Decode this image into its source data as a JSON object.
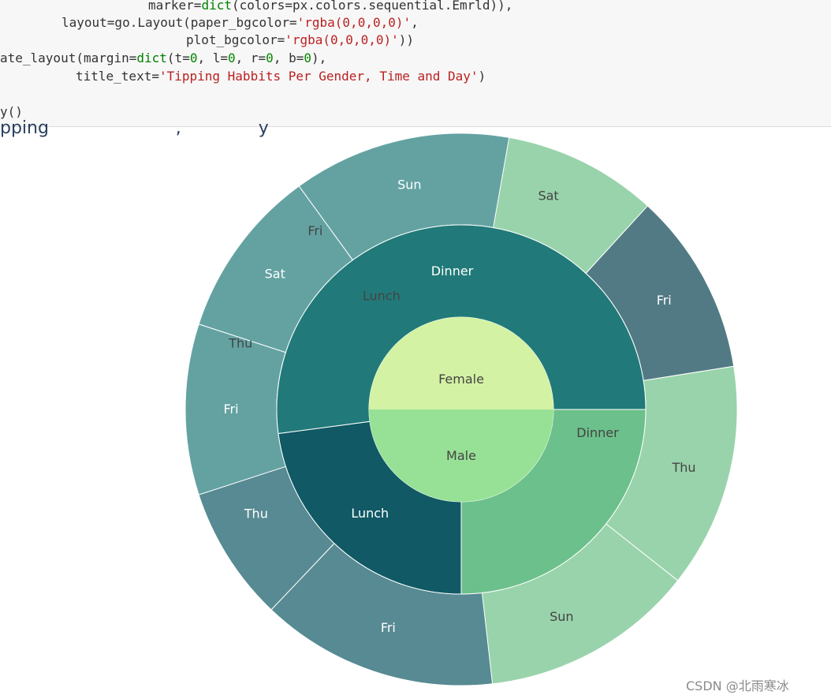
{
  "code_cell": {
    "line1": {
      "a": "marker=",
      "b": "dict",
      "c": "(colors=px.colors.sequential.Emrld)),"
    },
    "line2": {
      "a": "layout=go.Layout(paper_bgcolor=",
      "b": "'rgba(0,0,0,0)'",
      "c": ","
    },
    "line3": {
      "a": "plot_bgcolor=",
      "b": "'rgba(0,0,0,0)'",
      "c": "))"
    },
    "line4": {
      "a": "ate_layout(margin=",
      "b": "dict",
      "c": "(t=",
      "d": "0",
      "e": ", l=",
      "f": "0",
      "g": ", r=",
      "h": "0",
      "i": ", b=",
      "j": "0",
      "k": "),"
    },
    "line5": {
      "a": "title_text=",
      "b": "'Tipping Habbits Per Gender, Time and Day'",
      "c": ")"
    },
    "line6": {
      "a": "y()"
    }
  },
  "partial_title": "pping                       ,              y",
  "watermark": "CSDN @北雨寒冰",
  "chart_data": {
    "type": "sunburst",
    "title": "Tipping Habbits Per Gender, Time and Day",
    "color_scale": "Emrld",
    "nodes": [
      {
        "label": "Female",
        "level": 0,
        "start_deg": -90,
        "end_deg": 90,
        "color": "#d3f2a3",
        "text_color": "#444444"
      },
      {
        "label": "Male",
        "level": 0,
        "start_deg": 90,
        "end_deg": 270,
        "color": "#97e196",
        "text_color": "#444444"
      },
      {
        "label": "Lunch",
        "level": 1,
        "start_deg": -90,
        "end_deg": 19.6,
        "color": "#4c9b82",
        "text_color": "#444444",
        "parent": "Female"
      },
      {
        "label": "Dinner",
        "level": 1,
        "start_deg": 19.6,
        "end_deg": 180,
        "color": "#6cc08b",
        "text_color": "#444444",
        "parent": "Female"
      },
      {
        "label": "Lunch",
        "level": 1,
        "start_deg": 180,
        "end_deg": 262.5,
        "color": "#105965",
        "text_color": "#ffffff",
        "parent": "Male"
      },
      {
        "label": "Dinner",
        "level": 1,
        "start_deg": 262.5,
        "end_deg": 450,
        "color": "#217a79",
        "text_color": "#ffffff",
        "parent": "Male"
      },
      {
        "label": "Thu",
        "level": 2,
        "start_deg": -90,
        "end_deg": -56.7,
        "color": "#86bba8",
        "text_color": "#444444",
        "parent": "Female-Lunch"
      },
      {
        "label": "Fri",
        "level": 2,
        "start_deg": -56.7,
        "end_deg": -22,
        "color": "#86bba8",
        "text_color": "#444444",
        "parent": "Female-Lunch"
      },
      {
        "label": "Sat",
        "level": 2,
        "start_deg": 2,
        "end_deg": 42.5,
        "color": "#99d3ab",
        "text_color": "#444444",
        "parent": "Female-Dinner"
      },
      {
        "label": "Fri",
        "level": 2,
        "start_deg": 42.5,
        "end_deg": 81,
        "color": "#517a84",
        "text_color": "#ffffff",
        "parent": "Female-Dinner"
      },
      {
        "label": "Thu",
        "level": 2,
        "start_deg": 81,
        "end_deg": 128.3,
        "color": "#99d3ab",
        "text_color": "#444444",
        "parent": "Female-Dinner"
      },
      {
        "label": "Sun",
        "level": 2,
        "start_deg": 128.3,
        "end_deg": 180,
        "color": "#99d3ab",
        "text_color": "#444444",
        "parent": "Female-Dinner"
      },
      {
        "label": "Fri",
        "level": 2,
        "start_deg": 173.5,
        "end_deg": 223.5,
        "color": "#578a93",
        "text_color": "#ffffff",
        "parent": "Male-Lunch"
      },
      {
        "label": "Thu",
        "level": 2,
        "start_deg": 223.5,
        "end_deg": 262.5,
        "color": "#578a93",
        "text_color": "#ffffff",
        "parent": "Male-Lunch"
      },
      {
        "label": "Fri",
        "level": 2,
        "start_deg": 252,
        "end_deg": 288,
        "color": "#64a2a2",
        "text_color": "#ffffff",
        "parent": "Male-Dinner"
      },
      {
        "label": "Sat",
        "level": 2,
        "start_deg": 288,
        "end_deg": 324,
        "color": "#64a2a2",
        "text_color": "#ffffff",
        "parent": "Male-Dinner"
      },
      {
        "label": "Sun",
        "level": 2,
        "start_deg": 324,
        "end_deg": 370,
        "color": "#64a2a2",
        "text_color": "#ffffff",
        "parent": "Male-Dinner"
      }
    ]
  }
}
